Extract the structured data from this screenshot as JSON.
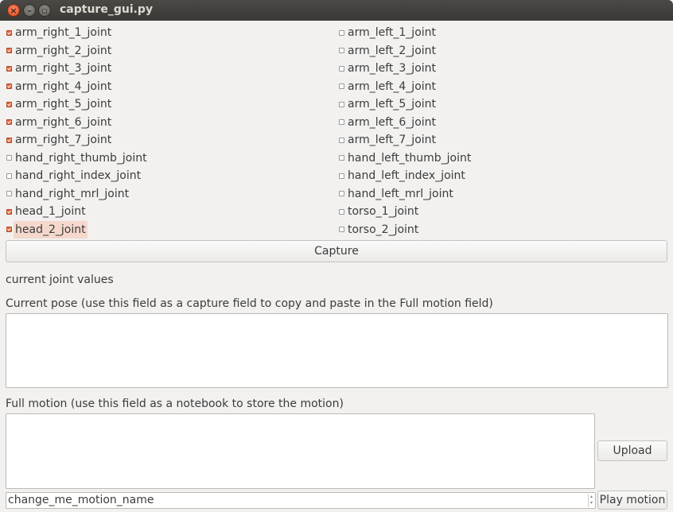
{
  "window": {
    "title": "capture_gui.py"
  },
  "joints_right": [
    {
      "label": "arm_right_1_joint",
      "checked": true
    },
    {
      "label": "arm_right_2_joint",
      "checked": true
    },
    {
      "label": "arm_right_3_joint",
      "checked": true
    },
    {
      "label": "arm_right_4_joint",
      "checked": true
    },
    {
      "label": "arm_right_5_joint",
      "checked": true
    },
    {
      "label": "arm_right_6_joint",
      "checked": true
    },
    {
      "label": "arm_right_7_joint",
      "checked": true
    },
    {
      "label": "hand_right_thumb_joint",
      "checked": false
    },
    {
      "label": "hand_right_index_joint",
      "checked": false
    },
    {
      "label": "hand_right_mrl_joint",
      "checked": false
    },
    {
      "label": "head_1_joint",
      "checked": true
    },
    {
      "label": "head_2_joint",
      "checked": true,
      "selected": true
    }
  ],
  "joints_left": [
    {
      "label": "arm_left_1_joint",
      "checked": false
    },
    {
      "label": "arm_left_2_joint",
      "checked": false
    },
    {
      "label": "arm_left_3_joint",
      "checked": false
    },
    {
      "label": "arm_left_4_joint",
      "checked": false
    },
    {
      "label": "arm_left_5_joint",
      "checked": false
    },
    {
      "label": "arm_left_6_joint",
      "checked": false
    },
    {
      "label": "arm_left_7_joint",
      "checked": false
    },
    {
      "label": "hand_left_thumb_joint",
      "checked": false
    },
    {
      "label": "hand_left_index_joint",
      "checked": false
    },
    {
      "label": "hand_left_mrl_joint",
      "checked": false
    },
    {
      "label": "torso_1_joint",
      "checked": false
    },
    {
      "label": "torso_2_joint",
      "checked": false
    }
  ],
  "capture_button": "Capture",
  "current_joint_values_label": "current joint values",
  "current_pose_label": "Current pose (use this field as a capture field to copy and paste in the Full motion field)",
  "current_pose_value": "",
  "full_motion_label": "Full motion (use this field as a notebook to store the motion)",
  "full_motion_value": "",
  "upload_button": "Upload",
  "motion_name_value": "change_me_motion_name",
  "play_motion_button": "Play motion",
  "colors": {
    "accent": "#e5623a",
    "selection": "#f5d8cc",
    "titlebar": "#3c3b37"
  }
}
